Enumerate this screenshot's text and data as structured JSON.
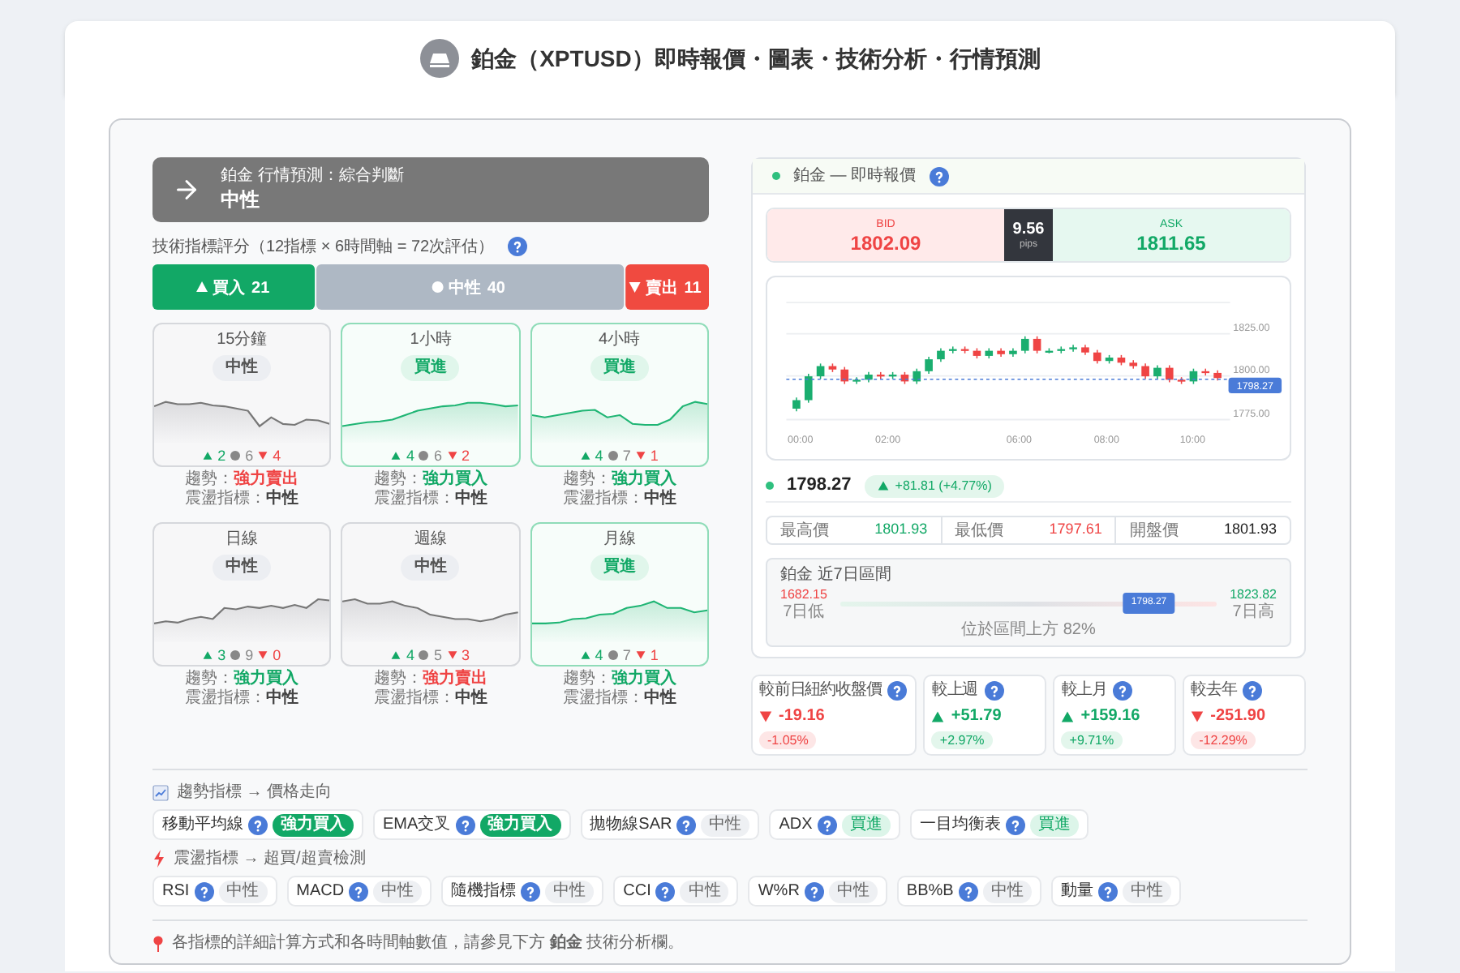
{
  "header": {
    "title": "鉑金（XPTUSD）即時報價・圖表・技術分析・行情預測"
  },
  "forecast": {
    "subtitle": "鉑金 行情預測：綜合判斷",
    "verdict": "中性",
    "kind": "neutral"
  },
  "score": {
    "label": "技術指標評分（12指標 × 6時間軸 = 72次評估）",
    "chart_data": {
      "type": "bar",
      "orientation": "horizontal",
      "stacked": true,
      "data_labels": true,
      "series": [
        {
          "name": "買入",
          "color": "#12a866",
          "values": [
            21
          ]
        },
        {
          "name": "中性",
          "color": "#aeb8c4",
          "values": [
            40
          ]
        },
        {
          "name": "賣出",
          "color": "#f04a40",
          "values": [
            11
          ]
        }
      ]
    }
  },
  "timeframes": [
    {
      "name": "15分鐘",
      "signal": "中性",
      "kind": "neutral",
      "buy": "2",
      "neutral": "6",
      "sell": "4",
      "trend_label": "趨勢：",
      "trend": {
        "text": "強力賣出",
        "kind": "sell"
      },
      "osc_label": "震盪指標：",
      "osc": "中性"
    },
    {
      "name": "1小時",
      "signal": "買進",
      "kind": "buy",
      "buy": "4",
      "neutral": "6",
      "sell": "2",
      "trend_label": "趨勢：",
      "trend": {
        "text": "強力買入",
        "kind": "buy"
      },
      "osc_label": "震盪指標：",
      "osc": "中性"
    },
    {
      "name": "4小時",
      "signal": "買進",
      "kind": "buy",
      "buy": "4",
      "neutral": "7",
      "sell": "1",
      "trend_label": "趨勢：",
      "trend": {
        "text": "強力買入",
        "kind": "buy"
      },
      "osc_label": "震盪指標：",
      "osc": "中性"
    },
    {
      "name": "日線",
      "signal": "中性",
      "kind": "neutral",
      "buy": "3",
      "neutral": "9",
      "sell": "0",
      "trend_label": "趨勢：",
      "trend": {
        "text": "強力買入",
        "kind": "buy"
      },
      "osc_label": "震盪指標：",
      "osc": "中性"
    },
    {
      "name": "週線",
      "signal": "中性",
      "kind": "neutral",
      "buy": "4",
      "neutral": "5",
      "sell": "3",
      "trend_label": "趨勢：",
      "trend": {
        "text": "強力賣出",
        "kind": "sell"
      },
      "osc_label": "震盪指標：",
      "osc": "中性"
    },
    {
      "name": "月線",
      "signal": "買進",
      "kind": "buy",
      "buy": "4",
      "neutral": "7",
      "sell": "1",
      "trend_label": "趨勢：",
      "trend": {
        "text": "強力買入",
        "kind": "buy"
      },
      "osc_label": "震盪指標：",
      "osc": "中性"
    }
  ],
  "quote": {
    "title": "鉑金 — 即時報價",
    "bid_label": "BID",
    "bid": "1802.09",
    "spread": "9.56",
    "spread_unit": "pips",
    "ask_label": "ASK",
    "ask": "1811.65",
    "chart": {
      "y_labels": [
        "1825.00",
        "1800.00",
        "1775.00"
      ],
      "x_labels": [
        "00:00",
        "02:00",
        "06:00",
        "08:00",
        "10:00"
      ],
      "price_tag": "1798.27"
    },
    "last": "1798.27",
    "change": {
      "text": "+81.81 (+4.77%)",
      "kind": "up"
    },
    "stats": [
      {
        "label": "最高價",
        "value": "1801.93",
        "kind": "high"
      },
      {
        "label": "最低價",
        "value": "1797.61",
        "kind": "low"
      },
      {
        "label": "開盤價",
        "value": "1801.93",
        "kind": "open"
      }
    ],
    "range": {
      "title": "鉑金 近7日區間",
      "low": "1682.15",
      "low_label": "7日低",
      "high": "1823.82",
      "high_label": "7日高",
      "marker": "1798.27",
      "level": 0.82,
      "caption": "位於區間上方 82%"
    }
  },
  "comparisons": [
    {
      "label": "較前日紐約收盤價",
      "value": "-19.16",
      "pct": "-1.05%",
      "kind": "down"
    },
    {
      "label": "較上週",
      "value": "+51.79",
      "pct": "+2.97%",
      "kind": "up"
    },
    {
      "label": "較上月",
      "value": "+159.16",
      "pct": "+9.71%",
      "kind": "up"
    },
    {
      "label": "較去年",
      "value": "-251.90",
      "pct": "-12.29%",
      "kind": "down"
    }
  ],
  "indicator_groups": [
    {
      "kind": "trend",
      "title": "趨勢指標 → 價格走向",
      "items": [
        {
          "name": "移動平均線",
          "signal": "強力買入",
          "kind": "strong_buy"
        },
        {
          "name": "EMA交叉",
          "signal": "強力買入",
          "kind": "strong_buy"
        },
        {
          "name": "拋物線SAR",
          "signal": "中性",
          "kind": "neutral"
        },
        {
          "name": "ADX",
          "signal": "買進",
          "kind": "buy"
        },
        {
          "name": "一目均衡表",
          "signal": "買進",
          "kind": "buy"
        }
      ]
    },
    {
      "kind": "oscillator",
      "title": "震盪指標 → 超買/超賣檢測",
      "items": [
        {
          "name": "RSI",
          "signal": "中性",
          "kind": "neutral"
        },
        {
          "name": "MACD",
          "signal": "中性",
          "kind": "neutral"
        },
        {
          "name": "隨機指標",
          "signal": "中性",
          "kind": "neutral"
        },
        {
          "name": "CCI",
          "signal": "中性",
          "kind": "neutral"
        },
        {
          "name": "W%R",
          "signal": "中性",
          "kind": "neutral"
        },
        {
          "name": "BB%B",
          "signal": "中性",
          "kind": "neutral"
        },
        {
          "name": "動量",
          "signal": "中性",
          "kind": "neutral"
        }
      ]
    }
  ],
  "note": "各指標的詳細計算方式和各時間軸數值，請參見下方 **鉑金** 技術分析欄。"
}
